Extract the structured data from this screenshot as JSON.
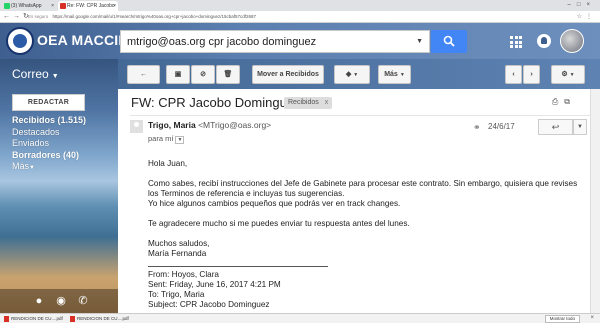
{
  "browser": {
    "tabs": [
      {
        "label": "(3) WhatsApp"
      },
      {
        "label": "Re: FW: CPR Jacobo Domi"
      }
    ],
    "url_secure": "Es seguro",
    "url": "https://mail.google.com/mail/u/1/#search/mtrigo%40oas.org+cpr+jacobo+dominguez/15cbaf57cdf2687"
  },
  "header": {
    "logo_text": "OEA MACCIH",
    "search_value": "mtrigo@oas.org cpr jacobo dominguez"
  },
  "sidebar": {
    "mail_label": "Correo",
    "compose_label": "REDACTAR",
    "items": [
      {
        "label": "Recibidos (1.515)",
        "bold": true
      },
      {
        "label": "Destacados",
        "bold": false
      },
      {
        "label": "Enviados",
        "bold": false
      },
      {
        "label": "Borradores (40)",
        "bold": true
      },
      {
        "label": "Más",
        "bold": false
      }
    ]
  },
  "toolbar": {
    "move_label": "Mover a Recibidos",
    "more_label": "Más"
  },
  "email": {
    "subject": "FW: CPR Jacobo Dominguez",
    "label_chip": "Recibidos",
    "label_chip_close": "x",
    "sender_name": "Trigo, Maria",
    "sender_email": "<MTrigo@oas.org>",
    "to_line": "para mí",
    "date": "24/6/17",
    "body_lines": [
      "Hola Juan,",
      "",
      "Como sabes, recibí instrucciones del Jefe de Gabinete para procesar este contrato. Sin embargo, quisiera que revises",
      "los Terminos de referencia e incluyas tus sugerencias.",
      "Yo hice algunos cambios pequeños que podrás ver en track changes.",
      "",
      "Te agradecere mucho si me puedes enviar tu respuesta antes del lunes.",
      "",
      "Muchos saludos,",
      "María Fernanda"
    ],
    "forward": {
      "from": "From: Hoyos, Clara",
      "sent": "Sent: Friday, June 16, 2017 4:21 PM",
      "to": "To: Trigo, Maria",
      "subject": "Subject: CPR Jacobo Dominguez"
    }
  },
  "downloads": {
    "items": [
      {
        "label": "RENDICION DE CU....pdf"
      },
      {
        "label": "RENDICION DE CU....pdf"
      }
    ],
    "show_all": "Mostrar todo"
  }
}
